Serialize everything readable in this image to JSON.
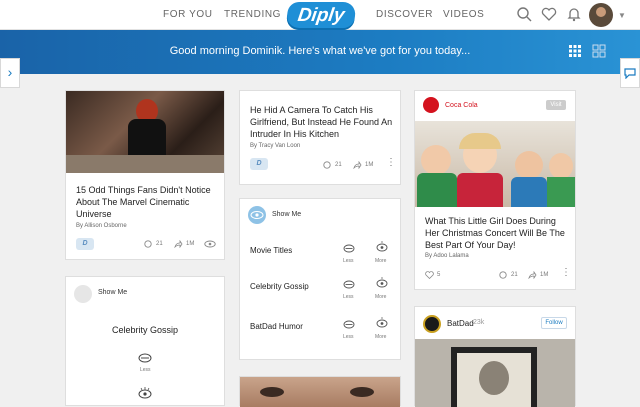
{
  "nav": {
    "left_links": [
      "FOR YOU",
      "TRENDING"
    ],
    "logo": "Diply",
    "right_links": [
      "DISCOVER",
      "VIDEOS"
    ]
  },
  "banner": {
    "greeting": "Good morning Dominik. Here's what we've got for you today..."
  },
  "cards": {
    "marvel": {
      "title": "15 Odd Things Fans Didn't Notice About The Marvel Cinematic Universe",
      "author": "By Allison Osborne",
      "comments": "21",
      "shares": "1M"
    },
    "camera": {
      "title": "He Hid A Camera To Catch His Girlfriend, But Instead He Found An Intruder In His Kitchen",
      "author": "By Tracy Van Loon",
      "comments": "21",
      "shares": "1M"
    },
    "showme_main": {
      "header": "Show Me",
      "rows": [
        "Movie Titles",
        "Celebrity Gossip",
        "BatDad Humor"
      ],
      "less": "Less",
      "more": "More"
    },
    "showme_left": {
      "header": "Show Me",
      "topic": "Celebrity Gossip",
      "less": "Less"
    },
    "cocacola": {
      "brand": "Coca Cola",
      "badge": "Visit",
      "title": "What This Little Girl Does During Her Christmas Concert Will Be The Best Part Of Your Day!",
      "author": "By Adoo Lalama",
      "likes": "5",
      "comments": "21",
      "shares": "1M"
    },
    "batdad": {
      "name": "BatDad",
      "followers": "23k",
      "follow": "Follow"
    }
  }
}
